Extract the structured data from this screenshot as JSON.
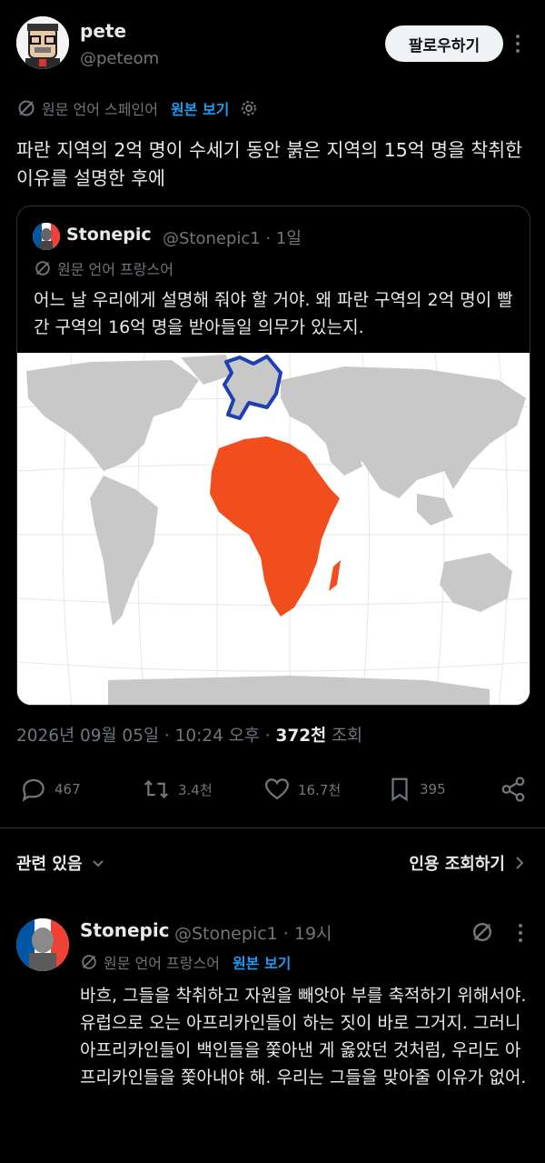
{
  "post": {
    "author_name": "pete",
    "author_handle": "@peteom",
    "follow_label": "팔로우하기",
    "translation_label": "원문 언어 스페인어",
    "show_original": "원본 보기",
    "text": "파란 지역의 2억 명이 수세기 동안 붉은 지역의 15억 명을 착취한 이유를 설명한 후에"
  },
  "quote": {
    "author_name": "Stonepic",
    "author_handle": "@Stonepic1 · 1일",
    "translation_label": "원문 언어 프랑스어",
    "text": "어느 날 우리에게 설명해 줘야 할 거야. 왜 파란 구역의 2억 명이 빨간 구역의 16억 명을 받아들일 의무가 있는지.",
    "map_colors": {
      "africa": "#f24d1c",
      "europe_outline": "#1c3fb5",
      "land": "#c8c8c8"
    }
  },
  "meta": {
    "datetime": "2026년 09월 05일 · 10:24 오후 · ",
    "views_num": "372천",
    "views_label": " 조회"
  },
  "actions": {
    "replies": "467",
    "reposts": "3.4천",
    "likes": "16.7천",
    "bookmarks": "395"
  },
  "section": {
    "related_label": "관련 있음",
    "quotes_label": "인용 조회하기"
  },
  "reply": {
    "author_name": "Stonepic",
    "author_handle": "@Stonepic1 · 19시",
    "translation_label": "원문 언어 프랑스어",
    "show_original": "원본 보기",
    "text": "바흐, 그들을 착취하고 자원을 빼앗아 부를 축적하기 위해서야.\n유럽으로 오는 아프리카인들이 하는 짓이 바로 그거지. 그러니 아프리카인들이 백인들을 쫓아낸 게 옳았던 것처럼, 우리도 아프리카인들을 쫓아내야 해. 우리는 그들을 맞아줄 이유가 없어."
  }
}
